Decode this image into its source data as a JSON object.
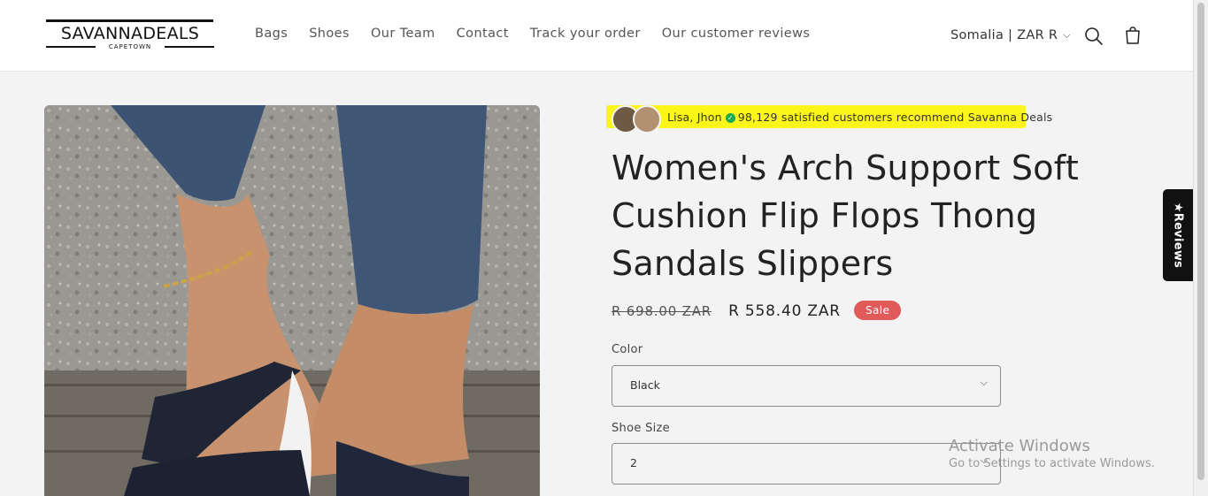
{
  "brand": {
    "name": "SAVANNADEALS",
    "city": "CAPETOWN"
  },
  "nav": [
    "Bags",
    "Shoes",
    "Our Team",
    "Contact",
    "Track your order",
    "Our customer reviews"
  ],
  "header": {
    "locale": "Somalia | ZAR R",
    "icons": [
      "search-icon",
      "cart-icon",
      "chevron-down-icon"
    ]
  },
  "social_proof": {
    "names": "Lisa, Jhon",
    "text": "98,129 satisfied customers recommend Savanna Deals"
  },
  "product": {
    "title": "Women's Arch Support Soft Cushion Flip Flops Thong Sandals Slippers",
    "price_old": "R 698.00 ZAR",
    "price_new": "R 558.40 ZAR",
    "badge": "Sale"
  },
  "options": {
    "color_label": "Color",
    "color_value": "Black",
    "size_label": "Shoe Size",
    "size_value": "2"
  },
  "reviews_tab": "★Reviews",
  "watermark": {
    "line1": "Activate Windows",
    "line2": "Go to Settings to activate Windows."
  },
  "colors": {
    "highlight": "#fbf51a",
    "sale": "#e05a5a",
    "check": "#1da851"
  }
}
